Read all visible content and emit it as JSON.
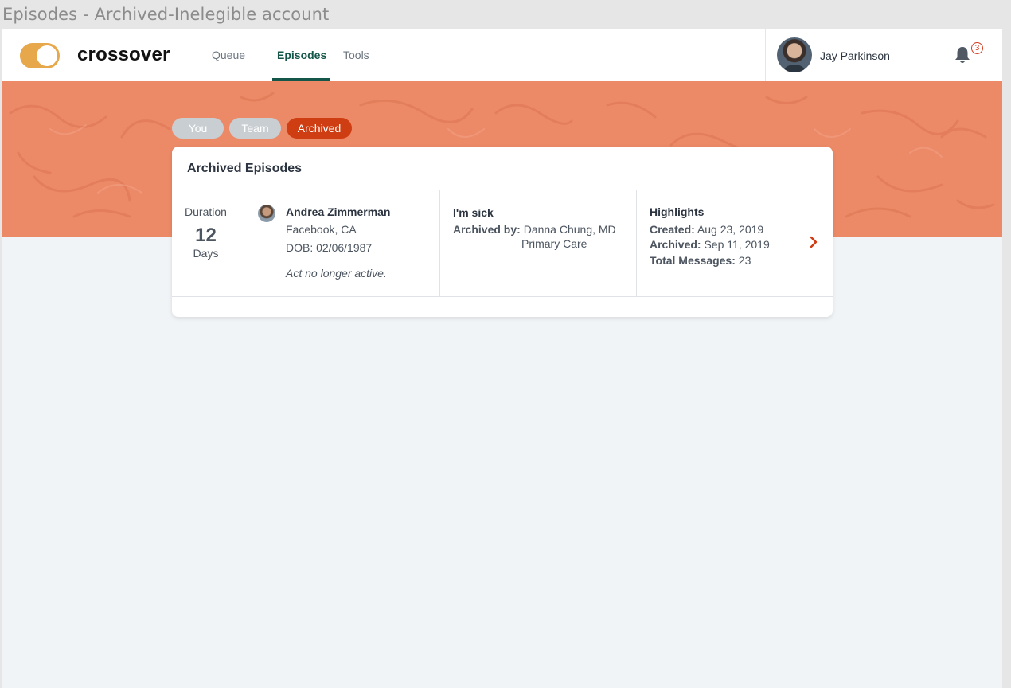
{
  "frame_title": "Episodes - Archived-Inelegible account",
  "brand": {
    "name": "crossover",
    "toggle_color": "#e7a84b"
  },
  "nav": {
    "links": [
      {
        "label": "Queue",
        "active": false
      },
      {
        "label": "Episodes",
        "active": true
      },
      {
        "label": "Tools",
        "active": false
      }
    ],
    "active_color": "#14564a"
  },
  "user": {
    "name": "Jay Parkinson",
    "notification_count": "3",
    "bell_icon": "bell-icon"
  },
  "banner": {
    "color": "#ec8a68"
  },
  "filters": [
    {
      "label": "You",
      "active": false
    },
    {
      "label": "Team",
      "active": false
    },
    {
      "label": "Archived",
      "active": true
    }
  ],
  "card": {
    "title": "Archived Episodes",
    "episode": {
      "duration_label": "Duration",
      "duration_value": "12",
      "duration_unit": "Days",
      "patient": {
        "name": "Andrea Zimmerman",
        "location": "Facebook, CA",
        "dob": "DOB: 02/06/1987",
        "note": "Act no longer active."
      },
      "reason": "I'm sick",
      "archived_by_label": "Archived by:",
      "archived_by_name": "Danna Chung, MD",
      "archived_by_dept": "Primary Care",
      "highlights": {
        "title": "Highlights",
        "created_label": "Created:",
        "created_value": "Aug 23, 2019",
        "archived_label": "Archived:",
        "archived_value": "Sep 11, 2019",
        "messages_label": "Total Messages:",
        "messages_value": "23"
      },
      "open_icon": "chevron-right-icon"
    }
  },
  "colors": {
    "accent": "#cf3d12",
    "pill_inactive": "#c9ced3",
    "page_bg": "#f1f4f7"
  }
}
